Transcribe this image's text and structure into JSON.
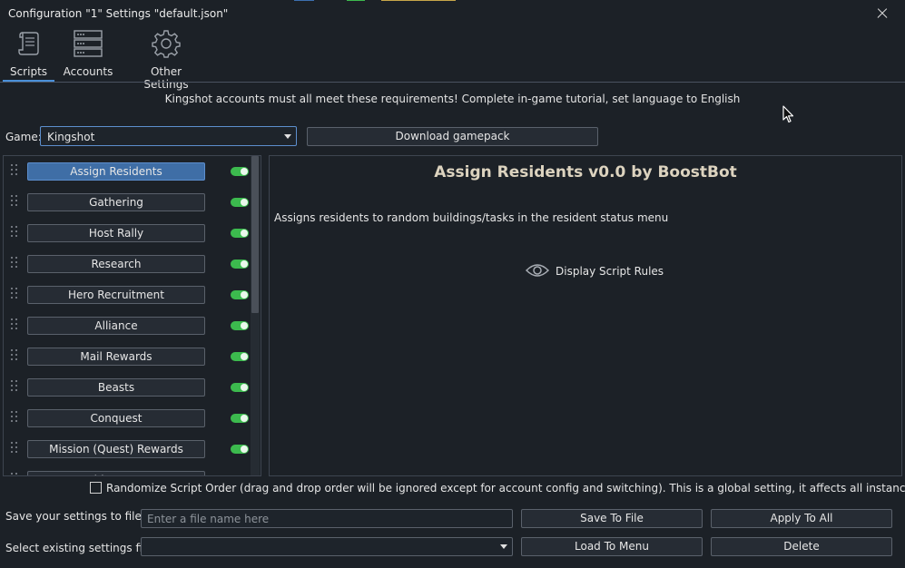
{
  "window": {
    "title": "Configuration \"1\" Settings \"default.json\""
  },
  "tabs": [
    {
      "label": "Scripts",
      "icon": "scroll-icon",
      "active": true
    },
    {
      "label": "Accounts",
      "icon": "server-icon",
      "active": false
    },
    {
      "label": "Other Settings",
      "icon": "gear-icon",
      "active": false
    }
  ],
  "notice": "Kingshot accounts must all meet these requirements! Complete in-game tutorial, set language to English",
  "game": {
    "label": "Game:",
    "selected": "Kingshot",
    "download_label": "Download gamepack"
  },
  "scripts": [
    {
      "name": "Assign Residents",
      "enabled": true,
      "selected": true
    },
    {
      "name": "Gathering",
      "enabled": true
    },
    {
      "name": "Host Rally",
      "enabled": true
    },
    {
      "name": "Research",
      "enabled": true
    },
    {
      "name": "Hero Recruitment",
      "enabled": true
    },
    {
      "name": "Alliance",
      "enabled": true
    },
    {
      "name": "Mail Rewards",
      "enabled": true
    },
    {
      "name": "Beasts",
      "enabled": true
    },
    {
      "name": "Conquest",
      "enabled": true
    },
    {
      "name": "Mission (Quest) Rewards",
      "enabled": true
    },
    {
      "name": "Ship Boost",
      "enabled": true
    }
  ],
  "detail": {
    "title": "Assign Residents v0.0 by BoostBot",
    "description": "Assigns residents to random buildings/tasks in the resident status menu",
    "rules_label": "Display Script Rules"
  },
  "randomize": {
    "checked": false,
    "label": "Randomize Script Order (drag and drop order will be ignored except for account config and switching). This is a global setting, it affects all instances."
  },
  "save": {
    "label": "Save your settings to file",
    "placeholder": "Enter a file name here",
    "save_button": "Save To File",
    "apply_button": "Apply To All"
  },
  "select": {
    "label": "Select existing settings file",
    "value": "",
    "load_button": "Load To Menu",
    "delete_button": "Delete"
  },
  "colors": {
    "background": "#1c2127",
    "accent": "#4a90d9",
    "selected_button": "#3f6ea6",
    "toggle_on": "#3cba4e",
    "title_text": "#dcd3bf"
  }
}
